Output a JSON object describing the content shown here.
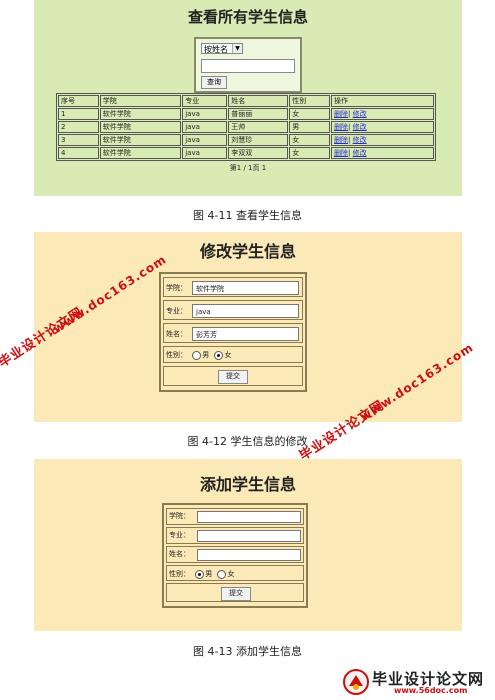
{
  "view": {
    "title": "查看所有学生信息",
    "filter_option": "按姓名",
    "search_button": "查询",
    "headers": [
      "序号",
      "学院",
      "专业",
      "姓名",
      "性别",
      "操作"
    ],
    "rows": [
      {
        "no": "1",
        "college": "软件学院",
        "major": "java",
        "name": "普丽丽",
        "gender": "女"
      },
      {
        "no": "2",
        "college": "软件学院",
        "major": "java",
        "name": "王帅",
        "gender": "男"
      },
      {
        "no": "3",
        "college": "软件学院",
        "major": "java",
        "name": "刘慧珍",
        "gender": "女"
      },
      {
        "no": "4",
        "college": "软件学院",
        "major": "java",
        "name": "李双双",
        "gender": "女"
      }
    ],
    "delete_label": "删除",
    "separator": "|",
    "edit_label": "修改",
    "pager": "第1 / 1页 1",
    "caption": "图 4-11   查看学生信息"
  },
  "edit": {
    "title": "修改学生信息",
    "college_label": "学院：",
    "college_value": "软件学院",
    "major_label": "专业：",
    "major_value": "java",
    "name_label": "姓名：",
    "name_value": "彭芳芳",
    "gender_label": "性别：",
    "male": "男",
    "female": "女",
    "selected_gender": "女",
    "submit": "提交",
    "caption": "图 4-12   学生信息的修改"
  },
  "add": {
    "title": "添加学生信息",
    "college_label": "学院：",
    "major_label": "专业：",
    "name_label": "姓名：",
    "gender_label": "性别：",
    "male": "男",
    "female": "女",
    "selected_gender": "男",
    "submit": "提交",
    "caption": "图 4-13   添加学生信息"
  },
  "watermarks": {
    "site": "毕业设计论文网",
    "url": "www.doc163.com",
    "footer_logo": "毕业设计论文网",
    "footer_url": "www.56doc.com"
  },
  "colors": {
    "green_panel": "#d8ebb4",
    "yellow_panel": "#fbe9b8",
    "link": "#2a2ad0",
    "watermark": "#cc1010"
  }
}
